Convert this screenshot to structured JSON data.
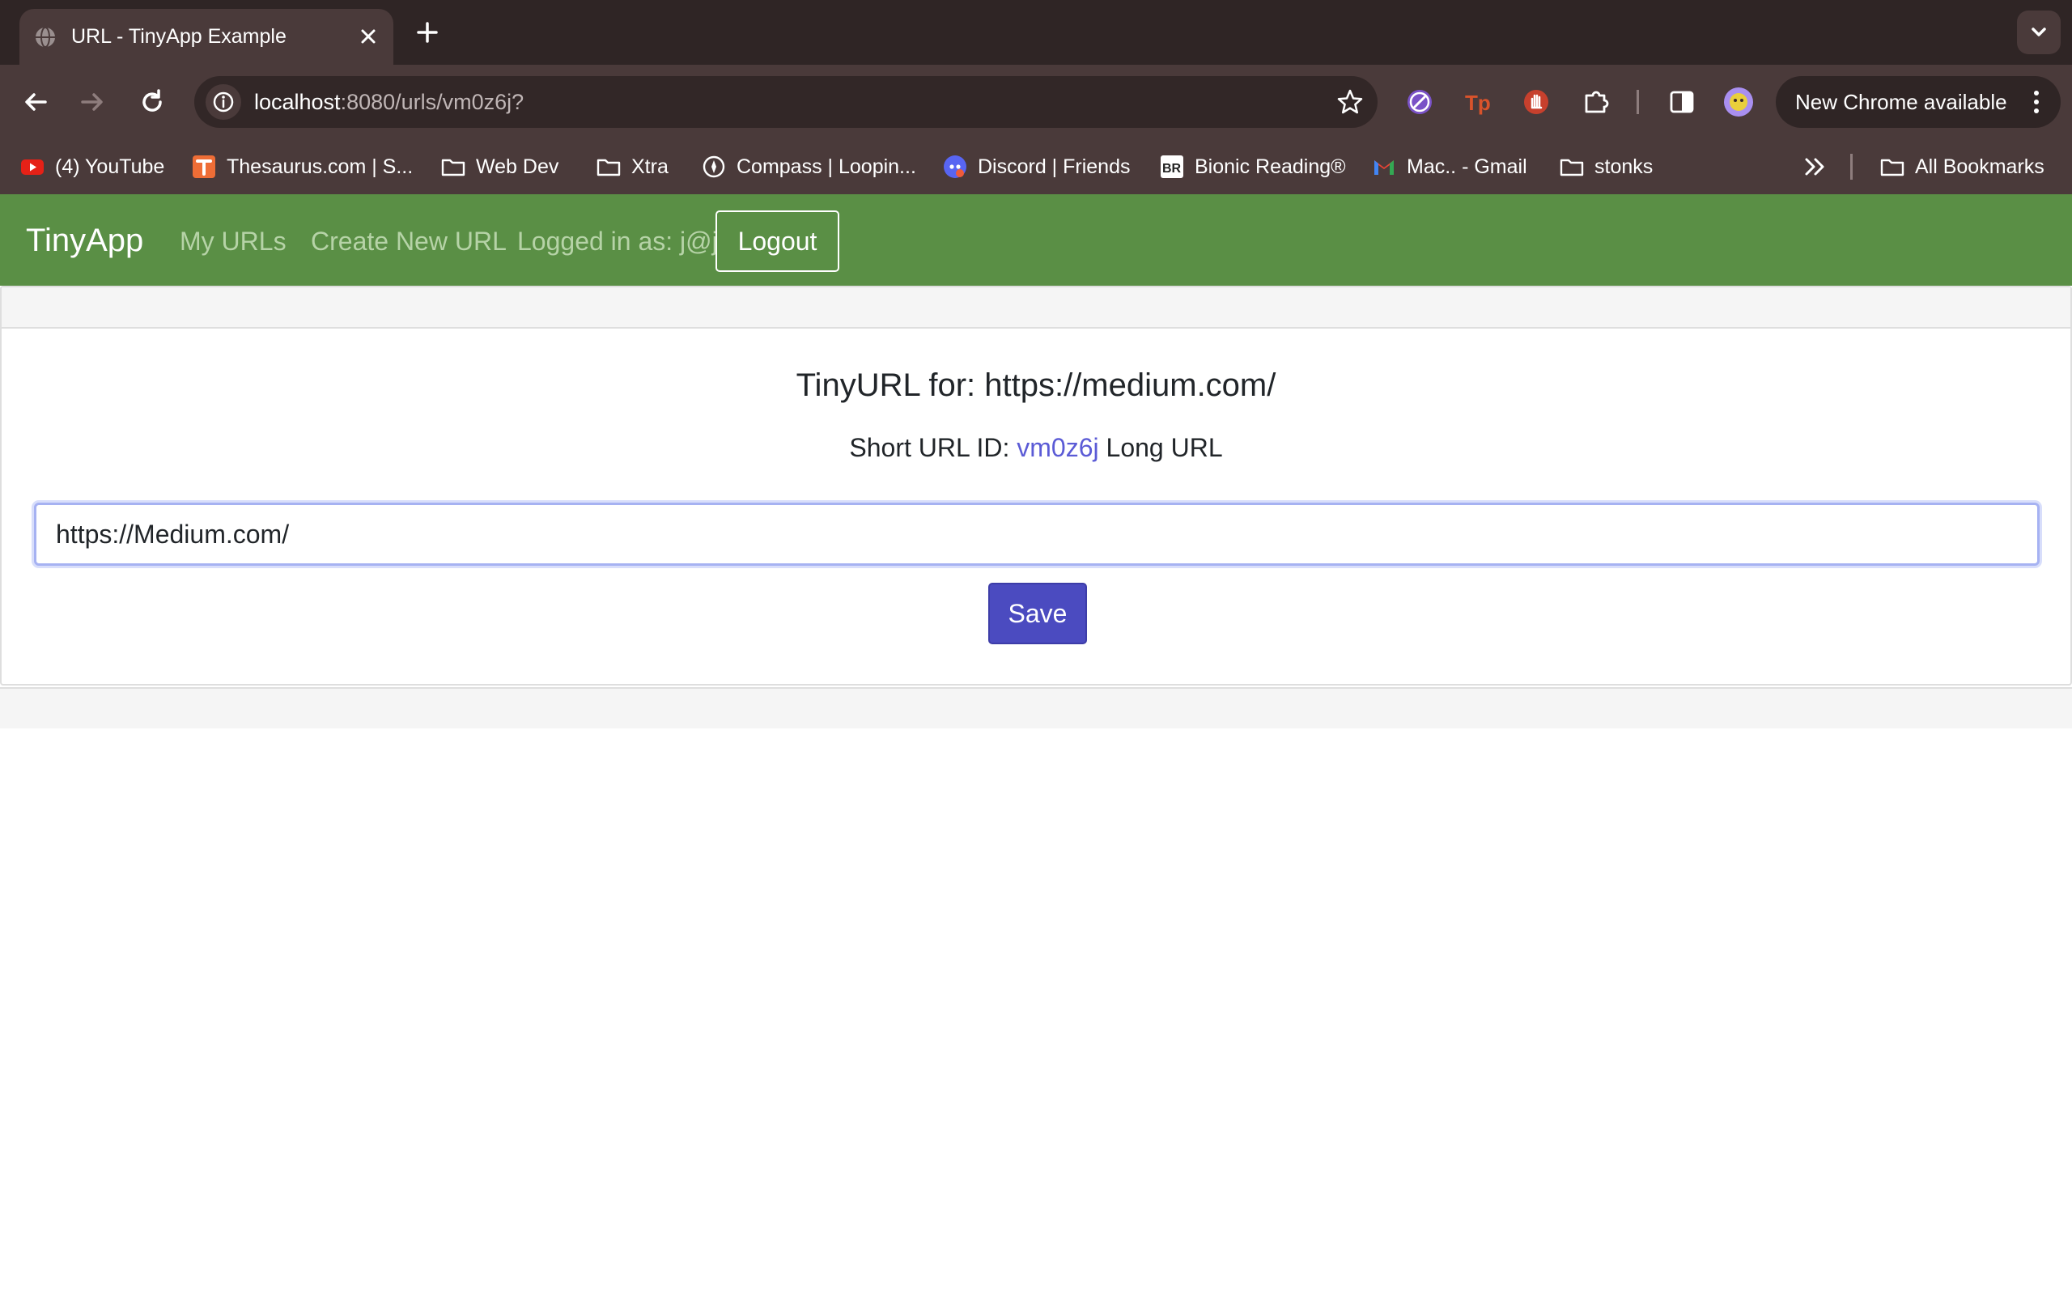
{
  "theme": {
    "tabstrip_bg": "#2f2525",
    "toolbar_bg": "#4a3a3a",
    "navbar_green": "#5a8f45",
    "save_button_blue": "#4b4bc0",
    "link_color": "#5b5bd6"
  },
  "browser": {
    "tab": {
      "title": "URL - TinyApp Example",
      "favicon": "globe-icon"
    },
    "address_bar": {
      "host": "localhost",
      "path": ":8080/urls/vm0z6j?"
    },
    "update_pill": {
      "label": "New Chrome available"
    },
    "extensions": [
      "compass-ext-icon",
      "tp-ext-icon",
      "hand-ext-icon",
      "puzzle-icon"
    ],
    "bookmarks": [
      {
        "label": "(4) YouTube",
        "icon": "youtube-icon"
      },
      {
        "label": "Thesaurus.com | S...",
        "icon": "thesaurus-icon"
      },
      {
        "label": "Web Dev",
        "icon": "folder-icon"
      },
      {
        "label": "Xtra",
        "icon": "folder-icon"
      },
      {
        "label": "Compass | Loopin...",
        "icon": "compass-icon"
      },
      {
        "label": "Discord | Friends",
        "icon": "discord-icon"
      },
      {
        "label": "Bionic Reading®",
        "icon": "bionic-reading-icon"
      },
      {
        "label": "Mac.. - Gmail",
        "icon": "gmail-icon"
      },
      {
        "label": "stonks",
        "icon": "folder-icon"
      }
    ],
    "all_bookmarks": {
      "label": "All Bookmarks",
      "icon": "folder-icon"
    }
  },
  "app": {
    "brand": "TinyApp",
    "nav": {
      "my_urls": "My URLs",
      "create_new": "Create New URL",
      "logged_in": "Logged in as: j@j",
      "logout": "Logout"
    },
    "card": {
      "title": "TinyURL for: https://medium.com/",
      "short_label": "Short URL ID:",
      "short_id": "vm0z6j",
      "long_label": "Long URL",
      "input_value": "https://Medium.com/",
      "save": "Save"
    }
  }
}
